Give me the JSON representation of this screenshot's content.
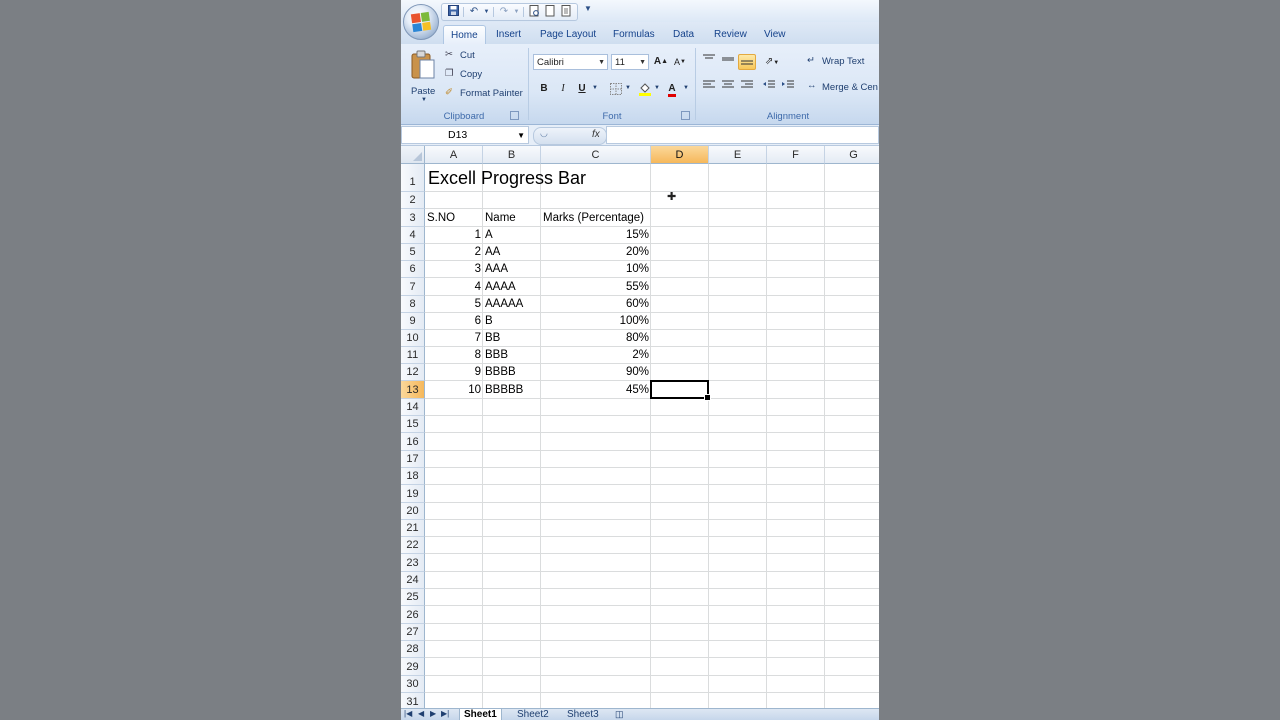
{
  "quick_access": {
    "icons": [
      "save-icon",
      "undo-icon",
      "redo-icon",
      "print-preview-icon",
      "new-icon",
      "open-icon",
      "customize-icon"
    ]
  },
  "ribbon": {
    "tabs": [
      {
        "label": "Home",
        "active": true
      },
      {
        "label": "Insert",
        "active": false
      },
      {
        "label": "Page Layout",
        "active": false
      },
      {
        "label": "Formulas",
        "active": false
      },
      {
        "label": "Data",
        "active": false
      },
      {
        "label": "Review",
        "active": false
      },
      {
        "label": "View",
        "active": false
      }
    ],
    "clipboard": {
      "label": "Clipboard",
      "paste": "Paste",
      "cut": "Cut",
      "copy": "Copy",
      "format_painter": "Format Painter"
    },
    "font": {
      "label": "Font",
      "font_name": "Calibri",
      "font_size": "11",
      "bold": "B",
      "italic": "I",
      "underline": "U",
      "grow": "A",
      "shrink": "A",
      "font_color_glyph": "A"
    },
    "alignment": {
      "label": "Alignment",
      "wrap_text": "Wrap Text",
      "merge_center": "Merge & Cen"
    }
  },
  "formula_bar": {
    "name_box": "D13",
    "fx": "fx",
    "value": ""
  },
  "grid": {
    "columns": [
      "A",
      "B",
      "C",
      "D",
      "E",
      "F",
      "G"
    ],
    "selected_column": "D",
    "rows": [
      "1",
      "2",
      "3",
      "4",
      "5",
      "6",
      "7",
      "8",
      "9",
      "10",
      "11",
      "12",
      "13",
      "14",
      "15",
      "16",
      "17",
      "18",
      "19",
      "20",
      "21",
      "22",
      "23",
      "24",
      "25",
      "26",
      "27",
      "28",
      "29",
      "30",
      "31"
    ],
    "selected_row": "13",
    "title": "Excell Progress Bar",
    "headers": [
      "S.NO",
      "Name",
      "Marks (Percentage)"
    ],
    "records": [
      {
        "sno": "1",
        "name": "A",
        "marks": "15%"
      },
      {
        "sno": "2",
        "name": "AA",
        "marks": "20%"
      },
      {
        "sno": "3",
        "name": "AAA",
        "marks": "10%"
      },
      {
        "sno": "4",
        "name": "AAAA",
        "marks": "55%"
      },
      {
        "sno": "5",
        "name": "AAAAA",
        "marks": "60%"
      },
      {
        "sno": "6",
        "name": "B",
        "marks": "100%"
      },
      {
        "sno": "7",
        "name": "BB",
        "marks": "80%"
      },
      {
        "sno": "8",
        "name": "BBB",
        "marks": "2%"
      },
      {
        "sno": "9",
        "name": "BBBB",
        "marks": "90%"
      },
      {
        "sno": "10",
        "name": "BBBBB",
        "marks": "45%"
      }
    ]
  },
  "sheets": {
    "tabs": [
      "Sheet1",
      "Sheet2",
      "Sheet3"
    ],
    "active": "Sheet1"
  },
  "colors": {
    "accent": "#15428b",
    "selection_header": "#f6b85b"
  }
}
